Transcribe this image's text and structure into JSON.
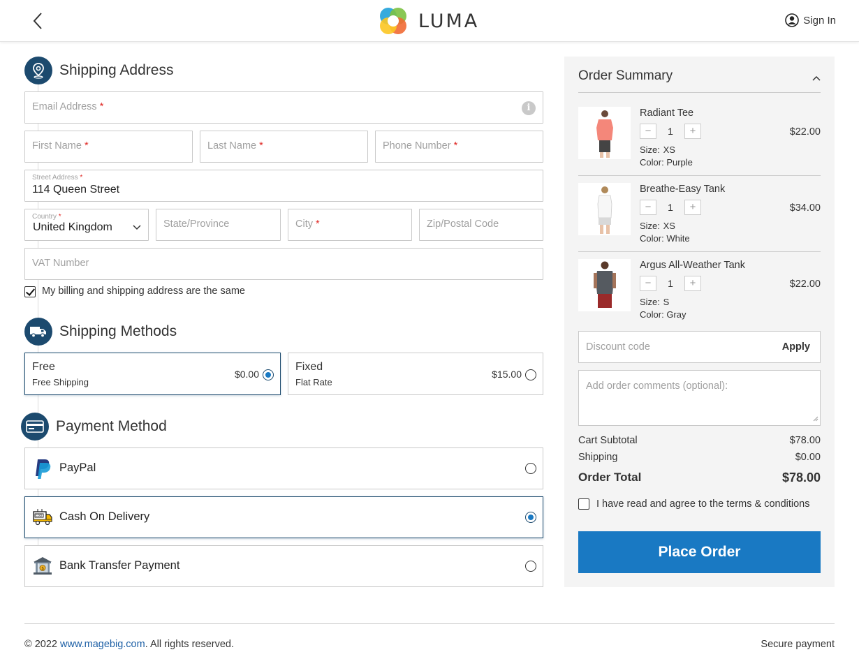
{
  "header": {
    "brand": "LUMA",
    "sign_in": "Sign In"
  },
  "shipping_address": {
    "title": "Shipping Address",
    "email_placeholder": "Email Address",
    "first_name_placeholder": "First Name",
    "last_name_placeholder": "Last Name",
    "phone_placeholder": "Phone Number",
    "street_label": "Street Address",
    "street_value": "114 Queen Street",
    "country_label": "Country",
    "country_value": "United Kingdom",
    "state_placeholder": "State/Province",
    "city_placeholder": "City",
    "zip_placeholder": "Zip/Postal Code",
    "vat_placeholder": "VAT Number",
    "required_mark": "*",
    "billing_same_label": "My billing and shipping address are the same",
    "billing_same_checked": true
  },
  "shipping_methods": {
    "title": "Shipping Methods",
    "options": [
      {
        "name": "Free",
        "desc": "Free Shipping",
        "price": "$0.00",
        "selected": true
      },
      {
        "name": "Fixed",
        "desc": "Flat Rate",
        "price": "$15.00",
        "selected": false
      }
    ]
  },
  "payment_method": {
    "title": "Payment Method",
    "options": [
      {
        "label": "PayPal",
        "icon": "paypal-icon",
        "selected": false
      },
      {
        "label": "Cash On Delivery",
        "icon": "cod-truck-icon",
        "selected": true
      },
      {
        "label": "Bank Transfer Payment",
        "icon": "bank-icon",
        "selected": false
      }
    ]
  },
  "order_summary": {
    "title": "Order Summary",
    "size_key": "Size:",
    "color_key": "Color:",
    "items": [
      {
        "name": "Radiant Tee",
        "qty": "1",
        "size": "XS",
        "color": "Purple",
        "price": "$22.00"
      },
      {
        "name": "Breathe-Easy Tank",
        "qty": "1",
        "size": "XS",
        "color": "White",
        "price": "$34.00"
      },
      {
        "name": "Argus All-Weather Tank",
        "qty": "1",
        "size": "S",
        "color": "Gray",
        "price": "$22.00"
      }
    ],
    "discount_placeholder": "Discount code",
    "apply_label": "Apply",
    "comments_placeholder": "Add order comments (optional):",
    "subtotal_label": "Cart Subtotal",
    "subtotal_value": "$78.00",
    "shipping_label": "Shipping",
    "shipping_value": "$0.00",
    "total_label": "Order Total",
    "total_value": "$78.00",
    "terms_label": "I have read and agree to the terms & conditions",
    "place_order_label": "Place Order"
  },
  "footer": {
    "copyright_prefix": "© 2022 ",
    "copyright_link": "www.magebig.com",
    "copyright_suffix": ". All rights reserved.",
    "secure": "Secure payment"
  },
  "colors": {
    "primary_button": "#1979c3",
    "section_icon": "#1c4a6e",
    "required": "#e02b27",
    "link": "#1c5fa5"
  }
}
